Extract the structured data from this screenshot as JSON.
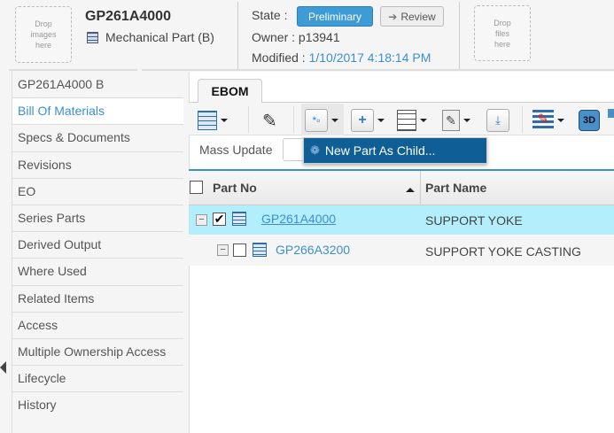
{
  "header": {
    "drop_images": "Drop images here",
    "part_number": "GP261A4000",
    "part_type": "Mechanical Part (B)",
    "state_label": "State :",
    "state_value": "Preliminary",
    "review_button": "Review",
    "owner": "Owner : p13941",
    "modified_label": "Modified :",
    "modified_value": "1/10/2017 4:18:14 PM",
    "drop_files": "Drop files here"
  },
  "sidebar": {
    "items": [
      {
        "label": "GP261A4000 B"
      },
      {
        "label": "Bill Of Materials"
      },
      {
        "label": "Specs & Documents"
      },
      {
        "label": "Revisions"
      },
      {
        "label": "EO"
      },
      {
        "label": "Series Parts"
      },
      {
        "label": "Derived Output"
      },
      {
        "label": "Where Used"
      },
      {
        "label": "Related Items"
      },
      {
        "label": "Access"
      },
      {
        "label": "Multiple Ownership Access"
      },
      {
        "label": "Lifecycle"
      },
      {
        "label": "History"
      }
    ],
    "active": "Bill Of Materials"
  },
  "tabs": [
    {
      "label": "EBOM"
    }
  ],
  "toolbar": {
    "mass_update": "Mass Update",
    "menu_item": "New Part As Child...",
    "three_d": "3D"
  },
  "grid": {
    "columns": [
      "Part No",
      "Part Name"
    ],
    "rows": [
      {
        "part_no": "GP261A4000",
        "part_name": "SUPPORT YOKE",
        "checked": true
      },
      {
        "part_no": "GP266A3200",
        "part_name": "SUPPORT YOKE CASTING",
        "checked": false
      }
    ]
  },
  "colors": {
    "accent": "#3b8fd1",
    "selected_row": "#b3eefc",
    "menu_bg": "#0f5f96"
  }
}
